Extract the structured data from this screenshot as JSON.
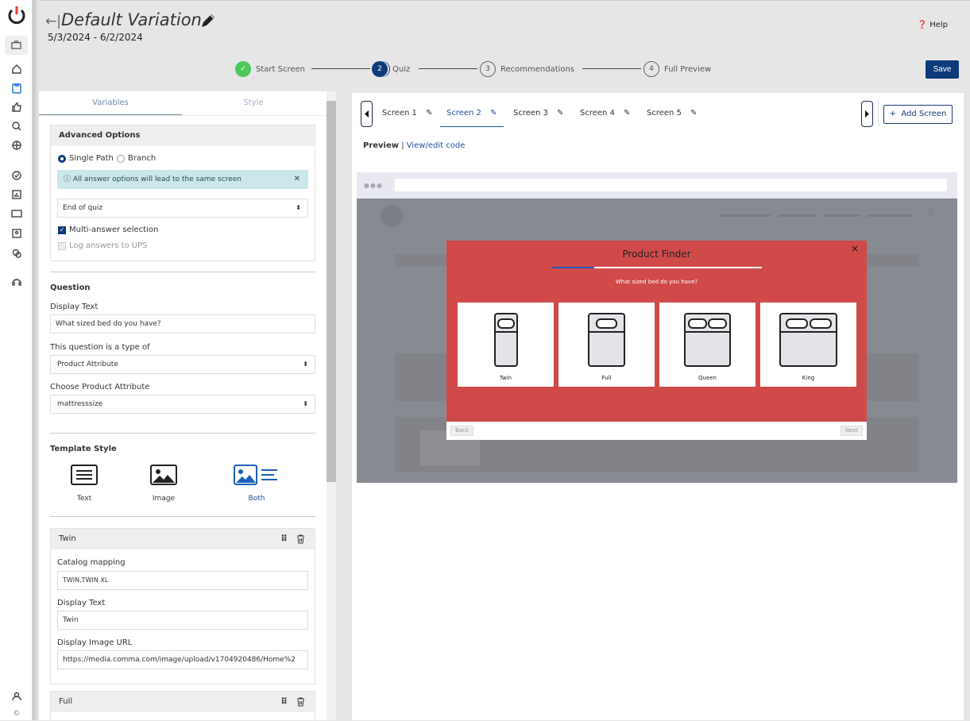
{
  "header": {
    "title": "Default Variation",
    "dates": "5/3/2024 - 6/2/2024",
    "help": "Help",
    "save": "Save"
  },
  "steps": [
    {
      "num": "✓",
      "label": "Start Screen"
    },
    {
      "num": "2",
      "label": "Quiz"
    },
    {
      "num": "3",
      "label": "Recommendations"
    },
    {
      "num": "4",
      "label": "Full Preview"
    }
  ],
  "left": {
    "tab_variables": "Variables",
    "tab_style": "Style",
    "advanced": {
      "title": "Advanced Options",
      "single_path": "Single Path",
      "branch": "Branch",
      "info": "All answer options will lead to the same screen",
      "dest": "End of quiz",
      "multi": "Multi-answer selection",
      "log": "Log answers to UPS"
    },
    "question": {
      "title": "Question",
      "display_label": "Display Text",
      "display_value": "What sized bed do you have?",
      "type_label": "This question is a type of",
      "type_value": "Product Attribute",
      "attr_label": "Choose Product Attribute",
      "attr_value": "mattresssize"
    },
    "template": {
      "title": "Template Style",
      "text": "Text",
      "image": "Image",
      "both": "Both"
    },
    "answer1": {
      "name": "Twin",
      "catalog_label": "Catalog mapping",
      "catalog_value": "TWIN,TWIN XL",
      "display_label": "Display Text",
      "display_value": "Twin",
      "url_label": "Display Image URL",
      "url_value": "https://media.comma.com/image/upload/v1704920486/Home%2"
    },
    "answer2": {
      "name": "Full"
    }
  },
  "right": {
    "screens": [
      "Screen 1",
      "Screen 2",
      "Screen 3",
      "Screen 4",
      "Screen 5"
    ],
    "add_screen": "Add Screen",
    "preview": "Preview",
    "edit_code": "View/edit code",
    "modal": {
      "title": "Product Finder",
      "close": "×",
      "question": "What sized bed do you have?",
      "progress": 0.2,
      "options": [
        "Twin",
        "Full",
        "Queen",
        "King"
      ],
      "back": "Back",
      "next": "Next"
    }
  },
  "colors": {
    "accent": "#0d3a7a",
    "modal": "#d04a4a",
    "success": "#4cc85c"
  }
}
